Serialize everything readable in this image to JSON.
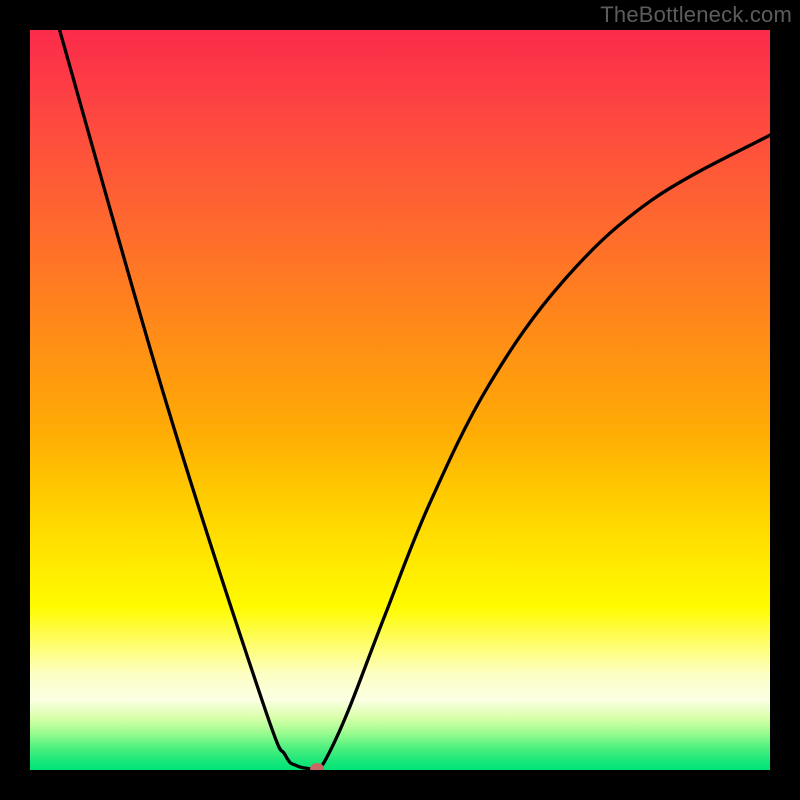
{
  "watermark": "TheBottleneck.com",
  "chart_data": {
    "type": "line",
    "title": "",
    "xlabel": "",
    "ylabel": "",
    "xlim": [
      0,
      100
    ],
    "ylim": [
      0,
      100
    ],
    "legend": false,
    "background": "rainbow_vertical_gradient",
    "left_branch": [
      {
        "x": 4.0,
        "y": 100
      },
      {
        "x": 18.3,
        "y": 50
      },
      {
        "x": 31.5,
        "y": 9
      },
      {
        "x": 34.5,
        "y": 2
      },
      {
        "x": 36.0,
        "y": 0.6
      },
      {
        "x": 37.8,
        "y": 0.15
      }
    ],
    "right_branch": [
      {
        "x": 37.8,
        "y": 0.15
      },
      {
        "x": 38.8,
        "y": 0.18
      },
      {
        "x": 40.0,
        "y": 1.5
      },
      {
        "x": 43.0,
        "y": 8
      },
      {
        "x": 48.0,
        "y": 21
      },
      {
        "x": 54.0,
        "y": 36
      },
      {
        "x": 62.0,
        "y": 52
      },
      {
        "x": 72.0,
        "y": 66
      },
      {
        "x": 84.0,
        "y": 77
      },
      {
        "x": 100.0,
        "y": 85.8
      }
    ],
    "marker": {
      "x": 38.8,
      "y": 0.2,
      "color": "#c76864"
    },
    "gradient_stops": [
      {
        "pos": 0,
        "color": "#fc2b4a"
      },
      {
        "pos": 50,
        "color": "#ff9f0e"
      },
      {
        "pos": 78,
        "color": "#fffb00"
      },
      {
        "pos": 100,
        "color": "#00e377"
      }
    ]
  }
}
